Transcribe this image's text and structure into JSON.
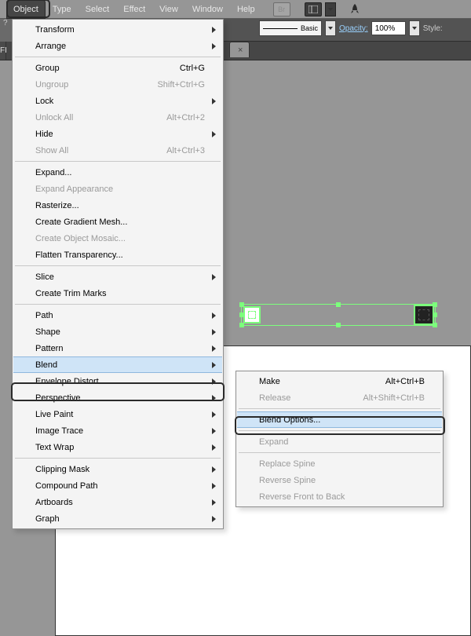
{
  "menubar": {
    "items": [
      "Object",
      "Type",
      "Select",
      "Effect",
      "View",
      "Window",
      "Help"
    ]
  },
  "optionsbar": {
    "stroke_style": "Basic",
    "opacity_label": "Opacity:",
    "opacity_value": "100%",
    "style_label": "Style:"
  },
  "tab": {
    "label": "",
    "close": "×"
  },
  "left_badge": "FI",
  "object_menu": [
    {
      "label": "Transform",
      "sub": true
    },
    {
      "label": "Arrange",
      "sub": true
    },
    {
      "sep": true
    },
    {
      "label": "Group",
      "shortcut": "Ctrl+G"
    },
    {
      "label": "Ungroup",
      "shortcut": "Shift+Ctrl+G",
      "disabled": true
    },
    {
      "label": "Lock",
      "sub": true
    },
    {
      "label": "Unlock All",
      "shortcut": "Alt+Ctrl+2",
      "disabled": true
    },
    {
      "label": "Hide",
      "sub": true
    },
    {
      "label": "Show All",
      "shortcut": "Alt+Ctrl+3",
      "disabled": true
    },
    {
      "sep": true
    },
    {
      "label": "Expand..."
    },
    {
      "label": "Expand Appearance",
      "disabled": true
    },
    {
      "label": "Rasterize..."
    },
    {
      "label": "Create Gradient Mesh..."
    },
    {
      "label": "Create Object Mosaic...",
      "disabled": true
    },
    {
      "label": "Flatten Transparency..."
    },
    {
      "sep": true
    },
    {
      "label": "Slice",
      "sub": true
    },
    {
      "label": "Create Trim Marks"
    },
    {
      "sep": true
    },
    {
      "label": "Path",
      "sub": true
    },
    {
      "label": "Shape",
      "sub": true
    },
    {
      "label": "Pattern",
      "sub": true
    },
    {
      "label": "Blend",
      "sub": true,
      "highlight": true
    },
    {
      "label": "Envelope Distort",
      "sub": true
    },
    {
      "label": "Perspective",
      "sub": true
    },
    {
      "label": "Live Paint",
      "sub": true
    },
    {
      "label": "Image Trace",
      "sub": true
    },
    {
      "label": "Text Wrap",
      "sub": true
    },
    {
      "sep": true
    },
    {
      "label": "Clipping Mask",
      "sub": true
    },
    {
      "label": "Compound Path",
      "sub": true
    },
    {
      "label": "Artboards",
      "sub": true
    },
    {
      "label": "Graph",
      "sub": true
    }
  ],
  "blend_menu": [
    {
      "label": "Make",
      "shortcut": "Alt+Ctrl+B"
    },
    {
      "label": "Release",
      "shortcut": "Alt+Shift+Ctrl+B",
      "disabled": true
    },
    {
      "sep": true
    },
    {
      "label": "Blend Options...",
      "highlight": true
    },
    {
      "sep": true
    },
    {
      "label": "Expand",
      "disabled": true
    },
    {
      "sep": true
    },
    {
      "label": "Replace Spine",
      "disabled": true
    },
    {
      "label": "Reverse Spine",
      "disabled": true
    },
    {
      "label": "Reverse Front to Back",
      "disabled": true
    }
  ]
}
